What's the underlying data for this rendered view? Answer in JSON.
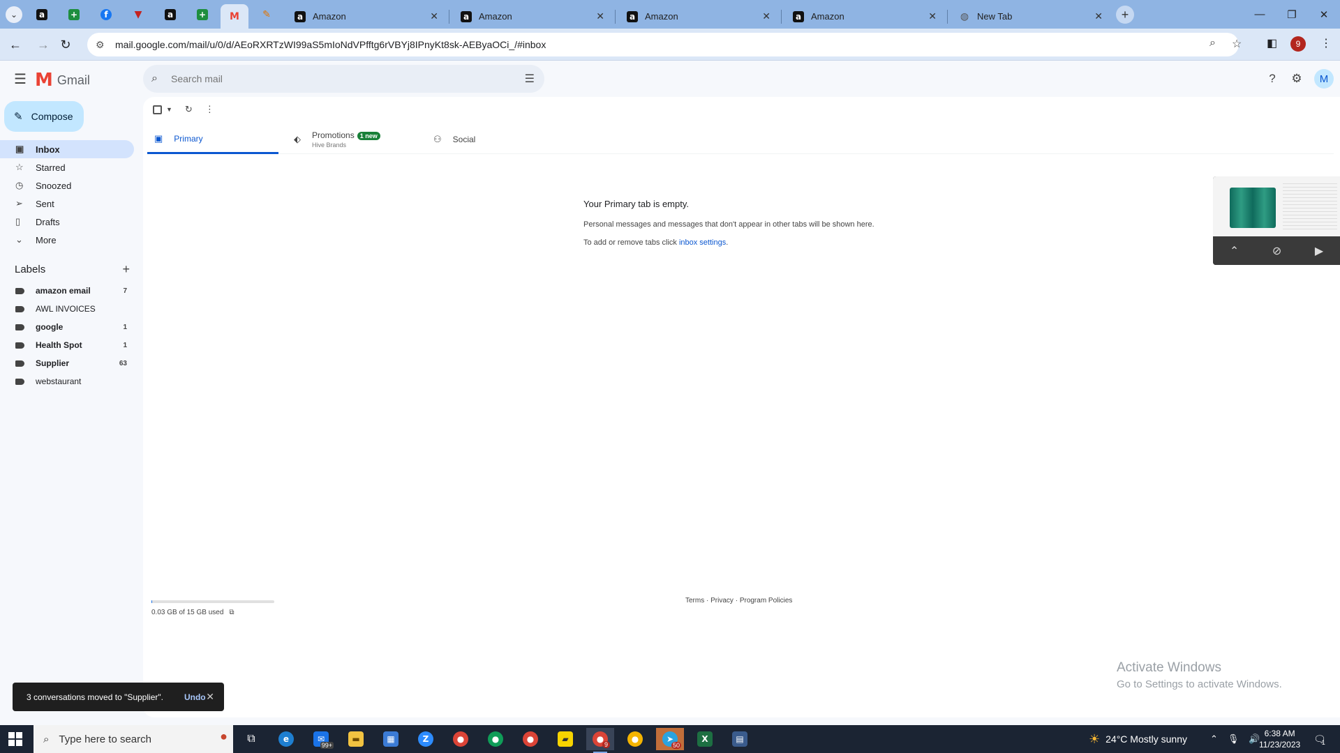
{
  "browser": {
    "tab_list_icon": "chevron-down-icon",
    "tabs": [
      {
        "title": "Amazon"
      },
      {
        "title": "Amazon"
      },
      {
        "title": "Amazon"
      },
      {
        "title": "Amazon"
      },
      {
        "title": "New Tab"
      }
    ],
    "address_url": "mail.google.com/mail/u/0/d/AEoRXRTzWI99aS5mIoNdVPfftg6rVBYj8IPnyKt8sk-AEByaOCi_/#inbox",
    "profile_initial": "9"
  },
  "gmail": {
    "logo_text": "Gmail",
    "search_placeholder": "Search mail",
    "avatar_initial": "M",
    "compose_label": "Compose",
    "nav": [
      {
        "label": "Inbox",
        "icon": "inbox-icon"
      },
      {
        "label": "Starred",
        "icon": "star-icon"
      },
      {
        "label": "Snoozed",
        "icon": "clock-icon"
      },
      {
        "label": "Sent",
        "icon": "send-icon"
      },
      {
        "label": "Drafts",
        "icon": "draft-icon"
      },
      {
        "label": "More",
        "icon": "chevron-down-icon"
      }
    ],
    "labels_heading": "Labels",
    "labels": [
      {
        "name": "amazon email",
        "count": "7"
      },
      {
        "name": "AWL INVOICES",
        "count": ""
      },
      {
        "name": "google",
        "count": "1"
      },
      {
        "name": "Health Spot",
        "count": "1"
      },
      {
        "name": "Supplier",
        "count": "63"
      },
      {
        "name": "webstaurant",
        "count": ""
      }
    ],
    "category_tabs": {
      "primary": "Primary",
      "promotions": "Promotions",
      "promotions_badge": "1 new",
      "promotions_sub": "Hive Brands",
      "social": "Social"
    },
    "empty_state": {
      "heading": "Your Primary tab is empty.",
      "line1": "Personal messages and messages that don't appear in other tabs will be shown here.",
      "line2_prefix": "To add or remove tabs click ",
      "line2_link": "inbox settings",
      "line2_suffix": "."
    },
    "storage": {
      "text": "0.03 GB of 15 GB used",
      "fraction": 0.002
    },
    "footer": {
      "terms": "Terms",
      "privacy": "Privacy",
      "policies": "Program Policies",
      "sep": " · "
    },
    "snackbar": {
      "message": "3 conversations moved to \"Supplier\".",
      "undo": "Undo"
    }
  },
  "watermark": {
    "title": "Activate Windows",
    "subtitle": "Go to Settings to activate Windows."
  },
  "taskbar": {
    "search_placeholder": "Type here to search",
    "badge_mail": "99+",
    "badge_chrome": "9",
    "badge_telegram": "50",
    "weather": "24°C  Mostly sunny",
    "time": "6:38 AM",
    "date": "11/23/2023",
    "notification_count": "1"
  }
}
